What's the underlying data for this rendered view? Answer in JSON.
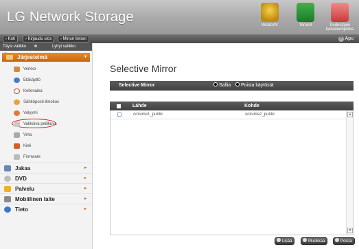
{
  "app": {
    "title": "LG Network Storage"
  },
  "header_icons": [
    {
      "label": "WebDAV",
      "icon": "webdav-icon"
    },
    {
      "label": "Torrent",
      "icon": "torrent-icon"
    },
    {
      "label": "Tiedostojen katseluohjelma",
      "icon": "file-viewer-icon"
    }
  ],
  "topnav": {
    "items": [
      "› Koti",
      "› Kirjaudu ulos",
      "› Minun tietoni"
    ],
    "help": "Apu"
  },
  "sidebar": {
    "tabs": [
      "Täysi valikko",
      "Lyhyt valikko"
    ],
    "section": "Järjestelmä",
    "subitems": [
      {
        "label": "Verkko",
        "icon": "network-icon"
      },
      {
        "label": "Etäkäyttö",
        "icon": "globe-icon"
      },
      {
        "label": "Kellonaika",
        "icon": "clock-icon"
      },
      {
        "label": "Sähköposti-ilmoitus",
        "icon": "email-icon"
      },
      {
        "label": "Volyymi",
        "icon": "volume-icon"
      },
      {
        "label": "Valikoiva peilikuva",
        "icon": "mirror-icon"
      },
      {
        "label": "Virta",
        "icon": "power-icon"
      },
      {
        "label": "Kieli",
        "icon": "language-icon"
      },
      {
        "label": "Firmware",
        "icon": "firmware-icon"
      }
    ],
    "main_items": [
      {
        "label": "Jakaa",
        "icon": "share-icon"
      },
      {
        "label": "DVD",
        "icon": "dvd-icon"
      },
      {
        "label": "Palvelu",
        "icon": "star-icon"
      },
      {
        "label": "Mobiilinen laite",
        "icon": "mobile-device-icon"
      },
      {
        "label": "Tieto",
        "icon": "info-icon"
      }
    ]
  },
  "main": {
    "title": "Selective Mirror",
    "setting": {
      "label": "Selective Mirror",
      "options": [
        "Sallia",
        "Poista käytöstä"
      ],
      "selected": "Sallia"
    },
    "table": {
      "headers": [
        "Lähde",
        "Kohde"
      ],
      "rows": [
        {
          "source": "/volume1_public",
          "target": "/volume2_public"
        }
      ]
    },
    "actions": [
      "Lisää",
      "Muokkaa",
      "Poista"
    ]
  },
  "colors": {
    "accent": "#c8650e",
    "header": "#a8a8a8",
    "bar": "#4a4a4a"
  }
}
